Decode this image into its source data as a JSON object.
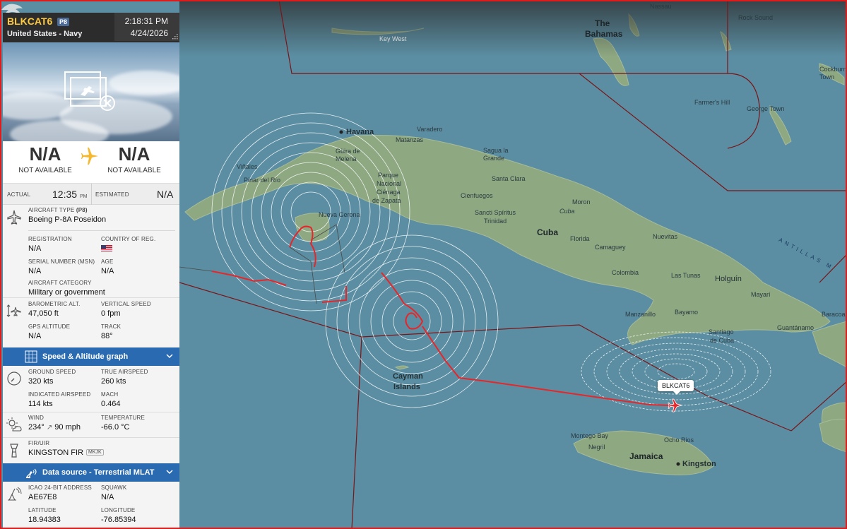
{
  "flight": {
    "callsign": "BLKCAT6",
    "type_code": "P8",
    "operator": "United States - Navy",
    "time": "2:18:31 PM",
    "date": "4/24/2026"
  },
  "route": {
    "origin_code": "N/A",
    "origin_sub": "NOT AVAILABLE",
    "dest_code": "N/A",
    "dest_sub": "NOT AVAILABLE"
  },
  "times": {
    "actual_label": "ACTUAL",
    "actual_value": "12:35",
    "actual_ampm": "PM",
    "estimated_label": "ESTIMATED",
    "estimated_value": "N/A"
  },
  "aircraft": {
    "type_label": "AIRCRAFT TYPE",
    "type_label_code": "(P8)",
    "type_value": "Boeing P-8A Poseidon",
    "registration_label": "REGISTRATION",
    "registration_value": "N/A",
    "country_label": "COUNTRY OF REG.",
    "msn_label": "SERIAL NUMBER (MSN)",
    "msn_value": "N/A",
    "age_label": "AGE",
    "age_value": "N/A",
    "category_label": "AIRCRAFT CATEGORY",
    "category_value": "Military or government"
  },
  "altitude": {
    "baro_label": "BAROMETRIC ALT.",
    "baro_value": "47,050 ft",
    "vs_label": "VERTICAL SPEED",
    "vs_value": "0 fpm",
    "gps_label": "GPS ALTITUDE",
    "gps_value": "N/A",
    "track_label": "TRACK",
    "track_value": "88°"
  },
  "graph_bar": {
    "label": "Speed & Altitude graph"
  },
  "speed": {
    "gs_label": "GROUND SPEED",
    "gs_value": "320 kts",
    "tas_label": "TRUE AIRSPEED",
    "tas_value": "260 kts",
    "ias_label": "INDICATED AIRSPEED",
    "ias_value": "114 kts",
    "mach_label": "MACH",
    "mach_value": "0.464"
  },
  "weather": {
    "wind_label": "WIND",
    "wind_dir": "234°",
    "wind_speed": "90 mph",
    "temp_label": "TEMPERATURE",
    "temp_value": "-66.0 °C"
  },
  "fir": {
    "label": "FIR/UIR",
    "value": "KINGSTON FIR",
    "code": "MKJK"
  },
  "source_bar": {
    "label": "Data source - Terrestrial MLAT"
  },
  "source": {
    "icao_label": "ICAO 24-BIT ADDRESS",
    "icao_value": "AE67E8",
    "squawk_label": "SQUAWK",
    "squawk_value": "N/A",
    "lat_label": "LATITUDE",
    "lat_value": "18.94383",
    "lon_label": "LONGITUDE",
    "lon_value": "-76.85394"
  },
  "map": {
    "aircraft_label": "BLKCAT6",
    "labels": {
      "nassau": "Nassau",
      "rock_sound": "Rock Sound",
      "key_west": "Key West",
      "the": "The",
      "bahamas": "Bahamas",
      "cockburn": "Cockburn",
      "town": "Town",
      "farmers_hill": "Farmer's Hill",
      "george_town": "George Town",
      "havana": "Havana",
      "varadero": "Varadero",
      "matanzas": "Matanzas",
      "guira": "Güira de",
      "melena": "Melena",
      "vinales": "Viñales",
      "pinar": "Pinar del Río",
      "parque": "Parque",
      "nacional": "Nacional",
      "cienaga": "Ciénaga",
      "zapata": "de Zapata",
      "sagua": "Sagua la",
      "grande": "Grande",
      "santa_clara": "Santa Clara",
      "cienfuegos": "Cienfuegos",
      "sancti": "Sancti Spíritus",
      "trinidad": "Trinidad",
      "moron": "Moron",
      "cuba_city": "Cuba",
      "cuba": "Cuba",
      "nueva_gerona": "Nueva Gerona",
      "nuevitas": "Nuevitas",
      "florida": "Florida",
      "camaguey": "Camaguey",
      "colombia": "Colombia",
      "las_tunas": "Las Tunas",
      "holguin": "Holguín",
      "mayari": "Mayarí",
      "baracoa": "Baracoa",
      "manzanillo": "Manzanillo",
      "bayamo": "Bayamo",
      "guantanamo": "Guantánamo",
      "santiago": "Santiago",
      "de_cuba": "de Cuba",
      "cayman": "Cayman",
      "islands": "Islands",
      "montego": "Montego Bay",
      "ocho": "Ocho Rios",
      "negril": "Negril",
      "jamaica": "Jamaica",
      "kingston": "Kingston",
      "antillas": "ANTILLAS M"
    },
    "colors": {
      "sea": "#5b8ea2",
      "land": "#8fa982",
      "track": "#e8262a",
      "fir_line": "#7a1518"
    }
  }
}
